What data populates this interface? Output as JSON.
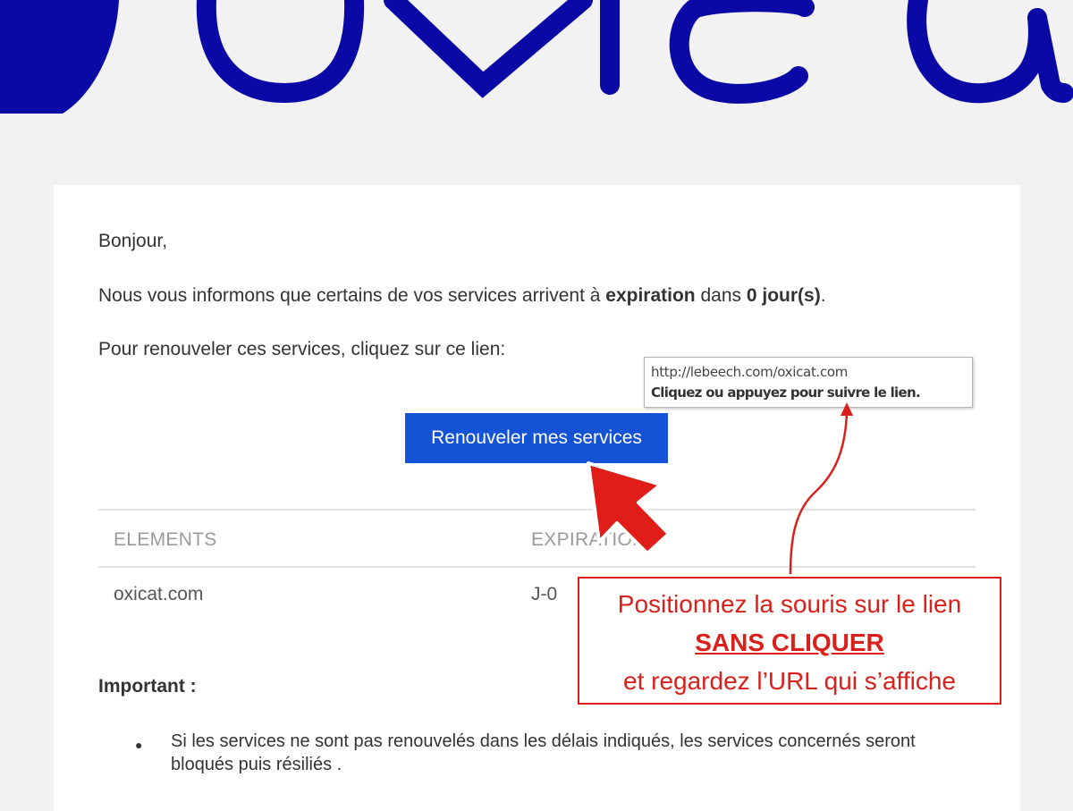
{
  "brand": {
    "logo_color": "#0a09a6"
  },
  "email": {
    "greeting": "Bonjour,",
    "info": {
      "prefix": "Nous vous informons que certains de vos services arrivent à ",
      "keyword": "expiration",
      "middle": " dans ",
      "days": "0 jour(s)",
      "suffix": "."
    },
    "renew_line": "Pour renouveler ces services, cliquez sur ce lien:",
    "renew_button": "Renouveler mes services",
    "table": {
      "headers": [
        "ELEMENTS",
        "EXPIRATION"
      ],
      "rows": [
        [
          "oxicat.com",
          "J-0"
        ]
      ]
    },
    "important_label": "Important :",
    "bullets": [
      "Si les services ne sont pas renouvelés dans les délais indiqués, les services concernés seront bloqués puis résiliés ."
    ]
  },
  "tooltip": {
    "url": "http://lebeech.com/oxicat.com",
    "hint": "Cliquez ou appuyez pour suivre le lien."
  },
  "callout": {
    "line1": "Positionnez la souris sur le lien",
    "line2": "SANS CLIQUER",
    "line3": "et regardez l’URL qui s’affiche",
    "color": "#d9201b"
  },
  "icons": {
    "cursor": "arrow-cursor-icon",
    "pointer_arrow": "curved-arrow-icon"
  }
}
